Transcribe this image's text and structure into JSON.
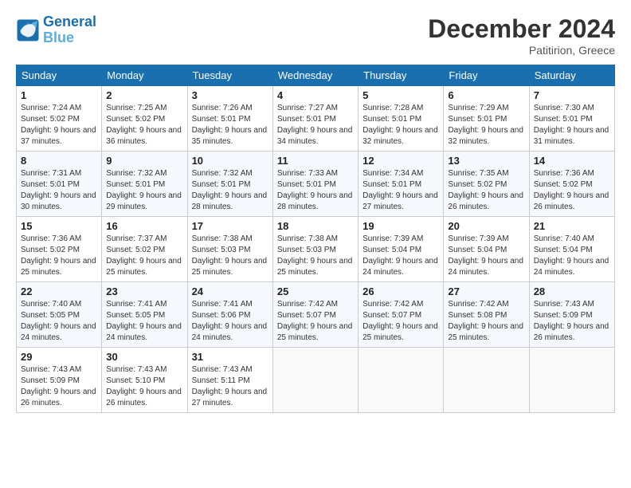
{
  "header": {
    "logo_line1": "General",
    "logo_line2": "Blue",
    "month_title": "December 2024",
    "location": "Patitirion, Greece"
  },
  "days_of_week": [
    "Sunday",
    "Monday",
    "Tuesday",
    "Wednesday",
    "Thursday",
    "Friday",
    "Saturday"
  ],
  "weeks": [
    [
      {
        "day": 1,
        "sunrise": "7:24 AM",
        "sunset": "5:02 PM",
        "daylight": "9 hours and 37 minutes."
      },
      {
        "day": 2,
        "sunrise": "7:25 AM",
        "sunset": "5:02 PM",
        "daylight": "9 hours and 36 minutes."
      },
      {
        "day": 3,
        "sunrise": "7:26 AM",
        "sunset": "5:01 PM",
        "daylight": "9 hours and 35 minutes."
      },
      {
        "day": 4,
        "sunrise": "7:27 AM",
        "sunset": "5:01 PM",
        "daylight": "9 hours and 34 minutes."
      },
      {
        "day": 5,
        "sunrise": "7:28 AM",
        "sunset": "5:01 PM",
        "daylight": "9 hours and 32 minutes."
      },
      {
        "day": 6,
        "sunrise": "7:29 AM",
        "sunset": "5:01 PM",
        "daylight": "9 hours and 32 minutes."
      },
      {
        "day": 7,
        "sunrise": "7:30 AM",
        "sunset": "5:01 PM",
        "daylight": "9 hours and 31 minutes."
      }
    ],
    [
      {
        "day": 8,
        "sunrise": "7:31 AM",
        "sunset": "5:01 PM",
        "daylight": "9 hours and 30 minutes."
      },
      {
        "day": 9,
        "sunrise": "7:32 AM",
        "sunset": "5:01 PM",
        "daylight": "9 hours and 29 minutes."
      },
      {
        "day": 10,
        "sunrise": "7:32 AM",
        "sunset": "5:01 PM",
        "daylight": "9 hours and 28 minutes."
      },
      {
        "day": 11,
        "sunrise": "7:33 AM",
        "sunset": "5:01 PM",
        "daylight": "9 hours and 28 minutes."
      },
      {
        "day": 12,
        "sunrise": "7:34 AM",
        "sunset": "5:01 PM",
        "daylight": "9 hours and 27 minutes."
      },
      {
        "day": 13,
        "sunrise": "7:35 AM",
        "sunset": "5:02 PM",
        "daylight": "9 hours and 26 minutes."
      },
      {
        "day": 14,
        "sunrise": "7:36 AM",
        "sunset": "5:02 PM",
        "daylight": "9 hours and 26 minutes."
      }
    ],
    [
      {
        "day": 15,
        "sunrise": "7:36 AM",
        "sunset": "5:02 PM",
        "daylight": "9 hours and 25 minutes."
      },
      {
        "day": 16,
        "sunrise": "7:37 AM",
        "sunset": "5:02 PM",
        "daylight": "9 hours and 25 minutes."
      },
      {
        "day": 17,
        "sunrise": "7:38 AM",
        "sunset": "5:03 PM",
        "daylight": "9 hours and 25 minutes."
      },
      {
        "day": 18,
        "sunrise": "7:38 AM",
        "sunset": "5:03 PM",
        "daylight": "9 hours and 25 minutes."
      },
      {
        "day": 19,
        "sunrise": "7:39 AM",
        "sunset": "5:04 PM",
        "daylight": "9 hours and 24 minutes."
      },
      {
        "day": 20,
        "sunrise": "7:39 AM",
        "sunset": "5:04 PM",
        "daylight": "9 hours and 24 minutes."
      },
      {
        "day": 21,
        "sunrise": "7:40 AM",
        "sunset": "5:04 PM",
        "daylight": "9 hours and 24 minutes."
      }
    ],
    [
      {
        "day": 22,
        "sunrise": "7:40 AM",
        "sunset": "5:05 PM",
        "daylight": "9 hours and 24 minutes."
      },
      {
        "day": 23,
        "sunrise": "7:41 AM",
        "sunset": "5:05 PM",
        "daylight": "9 hours and 24 minutes."
      },
      {
        "day": 24,
        "sunrise": "7:41 AM",
        "sunset": "5:06 PM",
        "daylight": "9 hours and 24 minutes."
      },
      {
        "day": 25,
        "sunrise": "7:42 AM",
        "sunset": "5:07 PM",
        "daylight": "9 hours and 25 minutes."
      },
      {
        "day": 26,
        "sunrise": "7:42 AM",
        "sunset": "5:07 PM",
        "daylight": "9 hours and 25 minutes."
      },
      {
        "day": 27,
        "sunrise": "7:42 AM",
        "sunset": "5:08 PM",
        "daylight": "9 hours and 25 minutes."
      },
      {
        "day": 28,
        "sunrise": "7:43 AM",
        "sunset": "5:09 PM",
        "daylight": "9 hours and 26 minutes."
      }
    ],
    [
      {
        "day": 29,
        "sunrise": "7:43 AM",
        "sunset": "5:09 PM",
        "daylight": "9 hours and 26 minutes."
      },
      {
        "day": 30,
        "sunrise": "7:43 AM",
        "sunset": "5:10 PM",
        "daylight": "9 hours and 26 minutes."
      },
      {
        "day": 31,
        "sunrise": "7:43 AM",
        "sunset": "5:11 PM",
        "daylight": "9 hours and 27 minutes."
      },
      null,
      null,
      null,
      null
    ]
  ]
}
